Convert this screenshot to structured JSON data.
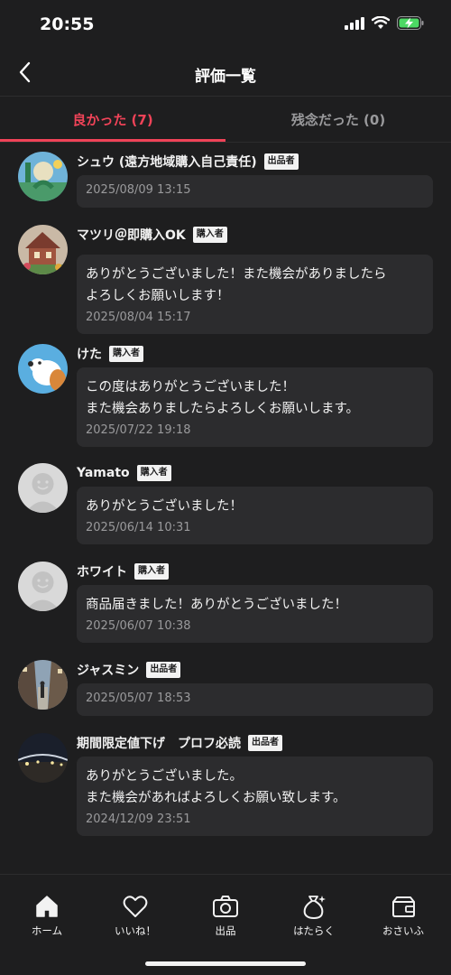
{
  "status": {
    "time": "20:55"
  },
  "nav": {
    "title": "評価一覧"
  },
  "tabs": [
    {
      "label": "良かった (7)",
      "active": true
    },
    {
      "label": "残念だった (0)",
      "active": false
    }
  ],
  "colors": {
    "accent": "#f04358",
    "background": "#1e1e1f",
    "bubble": "#2c2c2e",
    "muted": "#9a9a9c"
  },
  "reviews": [
    {
      "name": "シュウ (遠方地域購入自己責任)",
      "role": "出品者",
      "comment": "",
      "date": "2025/08/09 13:15",
      "avatar": "illustration"
    },
    {
      "name": "マツリ＠即購入OK",
      "role": "購入者",
      "comment": "ありがとうございました！また機会がありましたら\nよろしくお願いします！",
      "date": "2025/08/04 15:17",
      "avatar": "house-photo"
    },
    {
      "name": "けた",
      "role": "購入者",
      "comment": "この度はありがとうございました！\nまた機会ありましたらよろしくお願いします。",
      "date": "2025/07/22 19:18",
      "avatar": "dog-illustration"
    },
    {
      "name": "Yamato",
      "role": "購入者",
      "comment": "ありがとうございました！",
      "date": "2025/06/14 10:31",
      "avatar": "default"
    },
    {
      "name": "ホワイト",
      "role": "購入者",
      "comment": "商品届きました！ありがとうございました！",
      "date": "2025/06/07 10:38",
      "avatar": "default"
    },
    {
      "name": "ジャスミン",
      "role": "出品者",
      "comment": "",
      "date": "2025/05/07 18:53",
      "avatar": "street-photo"
    },
    {
      "name": "期間限定値下げ　プロフ必読",
      "role": "出品者",
      "comment": "ありがとうございました。\nまた機会があればよろしくお願い致します。",
      "date": "2024/12/09 23:51",
      "avatar": "night-photo"
    }
  ],
  "bottom_nav": [
    {
      "label": "ホーム",
      "icon": "home-icon"
    },
    {
      "label": "いいね！",
      "icon": "heart-icon"
    },
    {
      "label": "出品",
      "icon": "camera-icon"
    },
    {
      "label": "はたらく",
      "icon": "money-bag-icon"
    },
    {
      "label": "おさいふ",
      "icon": "wallet-icon"
    }
  ]
}
